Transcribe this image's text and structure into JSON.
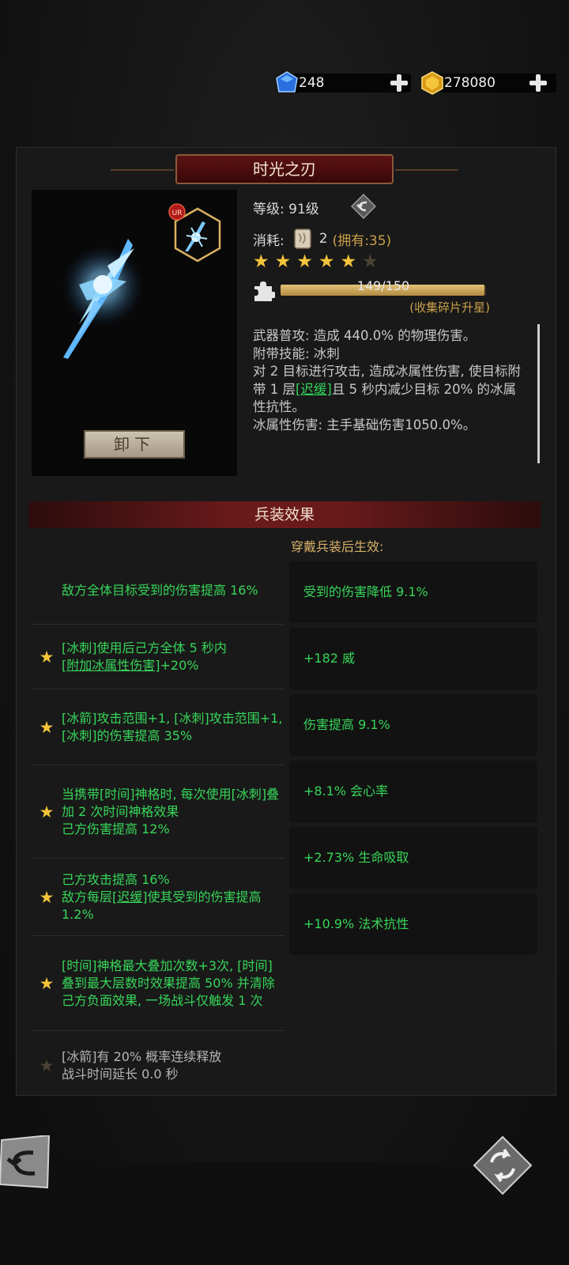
{
  "currency": {
    "gems": {
      "icon": "blue-gem-icon",
      "value": "248"
    },
    "gold": {
      "icon": "gold-gem-icon",
      "value": "278080"
    }
  },
  "item": {
    "name": "时光之刃",
    "rarity_badge": "UR",
    "level_label": "等级: 91级",
    "cost_label": "消耗:",
    "cost_count": "2",
    "cost_owned": "(拥有:35)",
    "stars_filled": 5,
    "stars_total": 6,
    "shards_text": "149/150",
    "shards_fraction": 0.9933,
    "shards_hint": "(收集碎片升星)",
    "unequip_label": "卸下",
    "desc": {
      "line1": "武器普攻: 造成 440.0% 的物理伤害。",
      "line2": "附带技能: 冰刺",
      "line3a": "对 2 目标进行攻击, 造成冰属性伤害, 使目标附带 1 层",
      "line3link": "[迟缓]",
      "line3b": "且 5 秒内减少目标 20% 的冰属性抗性。",
      "line4": "冰属性伤害: 主手基础伤害1050.0%。"
    }
  },
  "effects_section": {
    "title": "兵装效果",
    "note": "穿戴兵装后生效:",
    "effects": [
      {
        "star": "none",
        "text": "敌方全体目标受到的伤害提高 16%"
      },
      {
        "star": "on",
        "text_a": "[冰刺]使用后己方全体 5 秒内",
        "text_u": "[附加冰属性伤害]",
        "text_b": "+20%"
      },
      {
        "star": "on",
        "text": "[冰箭]攻击范围+1, [冰刺]攻击范围+1, [冰刺]的伤害提高 35%"
      },
      {
        "star": "on",
        "text": "当携带[时间]神格时, 每次使用[冰刺]叠加 2 次时间神格效果",
        "text2": "己方伤害提高 12%"
      },
      {
        "star": "on",
        "text": "己方攻击提高 16%",
        "text_a": "敌方每层",
        "text_u": "[迟缓]",
        "text_b": "使其受到的伤害提高 1.2%"
      },
      {
        "star": "on",
        "text": "[时间]神格最大叠加次数+3次, [时间]叠到最大层数时效果提高 50% 并清除己方负面效果, 一场战斗仅触发 1 次"
      },
      {
        "star": "off",
        "text": "[冰箭]有 20% 概率连续释放",
        "text2": "战斗时间延长 0.0 秒"
      }
    ],
    "bonuses": [
      "受到的伤害降低 9.1%",
      "+182 威",
      "伤害提高 9.1%",
      "+8.1% 会心率",
      "+2.73% 生命吸取",
      "+10.9% 法术抗性"
    ]
  },
  "colors": {
    "active_green": "#37d659",
    "gold": "#c9a04a",
    "banner_red": "#5c1212"
  }
}
